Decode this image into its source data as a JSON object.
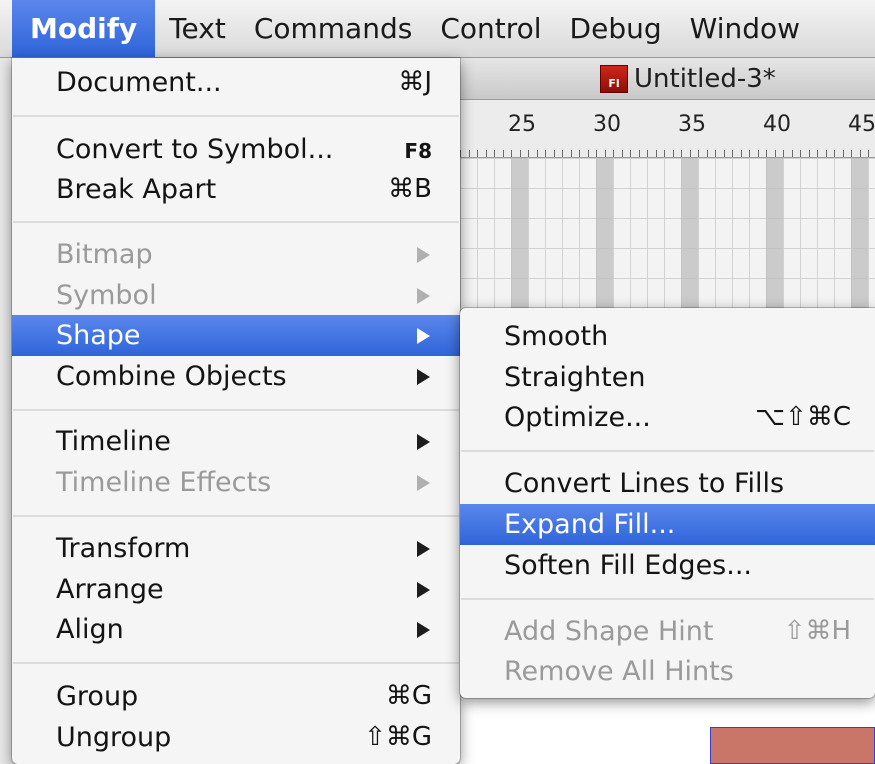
{
  "menubar": {
    "items": [
      "Modify",
      "Text",
      "Commands",
      "Control",
      "Debug",
      "Window"
    ],
    "active": "Modify"
  },
  "document": {
    "icon_text": "Fl",
    "title": "Untitled-3*",
    "ruler_labels": [
      "25",
      "30",
      "35",
      "40",
      "45"
    ]
  },
  "modify_menu": {
    "items": [
      {
        "label": "Document...",
        "shortcut": "⌘J"
      },
      {
        "label": "Convert to Symbol...",
        "shortcut": "F8"
      },
      {
        "label": "Break Apart",
        "shortcut": "⌘B"
      },
      {
        "label": "Bitmap",
        "state": "disabled",
        "submenu": true
      },
      {
        "label": "Symbol",
        "state": "disabled",
        "submenu": true
      },
      {
        "label": "Shape",
        "state": "highlighted",
        "submenu": true
      },
      {
        "label": "Combine Objects",
        "submenu": true
      },
      {
        "label": "Timeline",
        "submenu": true
      },
      {
        "label": "Timeline Effects",
        "state": "disabled",
        "submenu": true
      },
      {
        "label": "Transform",
        "submenu": true
      },
      {
        "label": "Arrange",
        "submenu": true
      },
      {
        "label": "Align",
        "submenu": true
      },
      {
        "label": "Group",
        "shortcut": "⌘G"
      },
      {
        "label": "Ungroup",
        "shortcut": "⇧⌘G"
      }
    ]
  },
  "shape_submenu": {
    "items": [
      {
        "label": "Smooth"
      },
      {
        "label": "Straighten"
      },
      {
        "label": "Optimize...",
        "shortcut": "⌥⇧⌘C"
      },
      {
        "label": "Convert Lines to Fills"
      },
      {
        "label": "Expand Fill...",
        "state": "highlighted"
      },
      {
        "label": "Soften Fill Edges..."
      },
      {
        "label": "Add Shape Hint",
        "shortcut": "⇧⌘H",
        "state": "disabled"
      },
      {
        "label": "Remove All Hints",
        "state": "disabled"
      }
    ]
  },
  "colors": {
    "highlight": "#3a6fe0",
    "disabled_text": "#9a9a9a",
    "shape_fill": "#c97668"
  }
}
